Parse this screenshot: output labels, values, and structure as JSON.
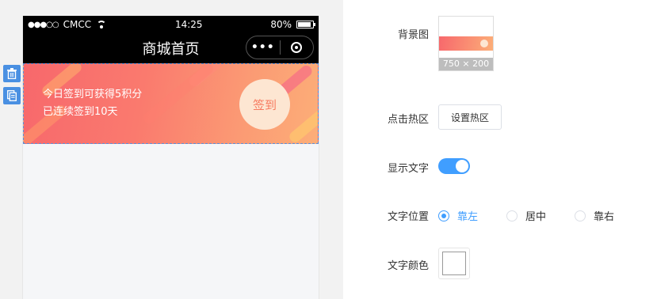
{
  "preview": {
    "status_bar": {
      "signal": "●●●○○",
      "carrier": "CMCC",
      "time": "14:25",
      "battery_pct": "80%",
      "battery_level": 0.8
    },
    "nav": {
      "title": "商城首页",
      "more": "•••"
    },
    "banner": {
      "line1": "今日签到可获得5积分",
      "line2": "已连续签到10天",
      "signin_label": "签到"
    }
  },
  "settings": {
    "background": {
      "label": "背景图",
      "size_caption": "750 × 200"
    },
    "hotzone": {
      "label": "点击热区",
      "button": "设置热区"
    },
    "show_text": {
      "label": "显示文字",
      "enabled": true
    },
    "text_position": {
      "label": "文字位置",
      "options": [
        "靠左",
        "居中",
        "靠右"
      ],
      "selected": "靠左"
    },
    "text_color": {
      "label": "文字颜色",
      "value": "#ffffff"
    }
  },
  "colors": {
    "accent": "#409eff",
    "banner_start": "#f7686c",
    "banner_end": "#fcae78"
  },
  "icons": {
    "delete": "trash-icon",
    "copy": "copy-icon"
  }
}
